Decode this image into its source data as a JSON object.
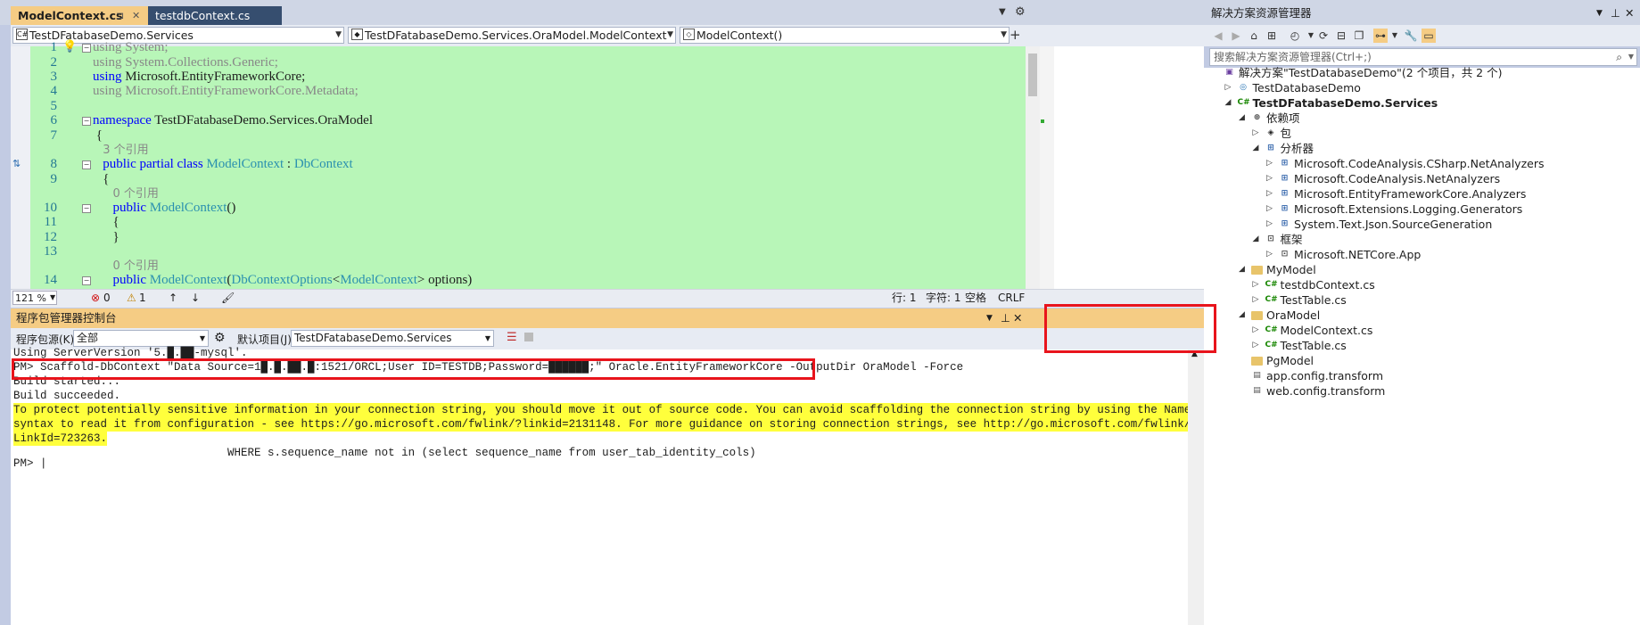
{
  "editor": {
    "tabs": [
      {
        "label": "ModelContext.cs",
        "active": true
      },
      {
        "label": "testdbContext.cs",
        "active": false
      }
    ],
    "tab_icons": {
      "pin": "⊐",
      "close": "✕"
    },
    "nav": {
      "project": "TestDFatabaseDemo.Services",
      "type": "TestDFatabaseDemo.Services.OraModel.ModelContext",
      "member": "ModelContext()"
    },
    "lines": [
      {
        "n": "1",
        "html": "<span class=\"gr\">using System;</span>"
      },
      {
        "n": "2",
        "html": "<span class=\"gr\">using System.Collections.Generic;</span>"
      },
      {
        "n": "3",
        "html": "<span class=\"kw\">using</span> Microsoft.EntityFrameworkCore;"
      },
      {
        "n": "4",
        "html": "<span class=\"gr\">using Microsoft.EntityFrameworkCore.Metadata;</span>"
      },
      {
        "n": "5",
        "html": ""
      },
      {
        "n": "6",
        "html": "<span class=\"kw\">namespace</span> TestDFatabaseDemo.Services.OraModel"
      },
      {
        "n": "7",
        "html": " {"
      },
      {
        "n": "",
        "html": "   <span class=\"ref\">3 个引用</span>"
      },
      {
        "n": "8",
        "html": "   <span class=\"kw\">public partial class</span> <span class=\"ty\">ModelContext</span> : <span class=\"ty\">DbContext</span>"
      },
      {
        "n": "9",
        "html": "   {"
      },
      {
        "n": "",
        "html": "      <span class=\"ref\">0 个引用</span>"
      },
      {
        "n": "10",
        "html": "      <span class=\"kw\">public</span> <span class=\"ty\">ModelContext</span>()"
      },
      {
        "n": "11",
        "html": "      {"
      },
      {
        "n": "12",
        "html": "      }"
      },
      {
        "n": "13",
        "html": ""
      },
      {
        "n": "",
        "html": "      <span class=\"ref\">0 个引用</span>"
      },
      {
        "n": "14",
        "html": "      <span class=\"kw\">public</span> <span class=\"ty\">ModelContext</span>(<span class=\"ty\">DbContextOptions</span>&lt;<span class=\"ty\">ModelContext</span>&gt; options)"
      }
    ],
    "status": {
      "zoom": "121 %",
      "errors": "0",
      "warnings": "1",
      "line": "行: 1",
      "col": "字符: 1",
      "spaces": "空格",
      "eol": "CRLF"
    }
  },
  "pmc": {
    "title": "程序包管理器控制台",
    "source_label": "程序包源(K):",
    "source_value": "全部",
    "project_label": "默认项目(J):",
    "project_value": "TestDFatabaseDemo.Services",
    "lines": [
      {
        "text": "Using ServerVersion '5.█.██-mysql'.",
        "hl": false
      },
      {
        "text": "PM> Scaffold-DbContext \"Data Source=1█.█.██.█:1521/ORCL;User ID=TESTDB;Password=██████;\" Oracle.EntityFrameworkCore -OutputDir OraModel -Force",
        "hl": false
      },
      {
        "text": "Build started...",
        "hl": false
      },
      {
        "text": "Build succeeded.",
        "hl": false
      },
      {
        "text": "To protect potentially sensitive information in your connection string, you should move it out of source code. You can avoid scaffolding the connection string by using the Name=",
        "hl": true
      },
      {
        "text": "syntax to read it from configuration - see https://go.microsoft.com/fwlink/?linkid=2131148. For more guidance on storing connection strings, see http://go.microsoft.com/fwlink/?",
        "hl": true
      },
      {
        "text": "LinkId=723263.",
        "hl": true
      },
      {
        "text": "                                WHERE s.sequence_name not in (select sequence_name from user_tab_identity_cols)",
        "hl": false
      },
      {
        "text": "",
        "hl": false
      },
      {
        "text": "PM> |",
        "hl": false
      }
    ]
  },
  "solution": {
    "title": "解决方案资源管理器",
    "search_placeholder": "搜索解决方案资源管理器(Ctrl+;)",
    "nodes": [
      {
        "label": "解决方案\"TestDatabaseDemo\"(2 个项目，共 2 个)",
        "depth": 0,
        "tri": "",
        "icon": "sln",
        "bold": false
      },
      {
        "label": "TestDatabaseDemo",
        "depth": 1,
        "tri": "▷",
        "icon": "web",
        "bold": false
      },
      {
        "label": "TestDFatabaseDemo.Services",
        "depth": 1,
        "tri": "◢",
        "icon": "csproj",
        "bold": true
      },
      {
        "label": "依赖项",
        "depth": 2,
        "tri": "◢",
        "icon": "deps",
        "bold": false
      },
      {
        "label": "包",
        "depth": 3,
        "tri": "▷",
        "icon": "pkg",
        "bold": false
      },
      {
        "label": "分析器",
        "depth": 3,
        "tri": "◢",
        "icon": "analyzer",
        "bold": false
      },
      {
        "label": "Microsoft.CodeAnalysis.CSharp.NetAnalyzers",
        "depth": 4,
        "tri": "▷",
        "icon": "analyzer",
        "bold": false
      },
      {
        "label": "Microsoft.CodeAnalysis.NetAnalyzers",
        "depth": 4,
        "tri": "▷",
        "icon": "analyzer",
        "bold": false
      },
      {
        "label": "Microsoft.EntityFrameworkCore.Analyzers",
        "depth": 4,
        "tri": "▷",
        "icon": "analyzer",
        "bold": false
      },
      {
        "label": "Microsoft.Extensions.Logging.Generators",
        "depth": 4,
        "tri": "▷",
        "icon": "analyzer",
        "bold": false
      },
      {
        "label": "System.Text.Json.SourceGeneration",
        "depth": 4,
        "tri": "▷",
        "icon": "analyzer",
        "bold": false
      },
      {
        "label": "框架",
        "depth": 3,
        "tri": "◢",
        "icon": "fw",
        "bold": false
      },
      {
        "label": "Microsoft.NETCore.App",
        "depth": 4,
        "tri": "▷",
        "icon": "fw",
        "bold": false
      },
      {
        "label": "MyModel",
        "depth": 2,
        "tri": "◢",
        "icon": "folder",
        "bold": false
      },
      {
        "label": "testdbContext.cs",
        "depth": 3,
        "tri": "▷",
        "icon": "cs",
        "bold": false
      },
      {
        "label": "TestTable.cs",
        "depth": 3,
        "tri": "▷",
        "icon": "cs",
        "bold": false
      },
      {
        "label": "OraModel",
        "depth": 2,
        "tri": "◢",
        "icon": "folder",
        "bold": false
      },
      {
        "label": "ModelContext.cs",
        "depth": 3,
        "tri": "▷",
        "icon": "cs",
        "bold": false
      },
      {
        "label": "TestTable.cs",
        "depth": 3,
        "tri": "▷",
        "icon": "cs",
        "bold": false
      },
      {
        "label": "PgModel",
        "depth": 2,
        "tri": "",
        "icon": "folder",
        "bold": false
      },
      {
        "label": "app.config.transform",
        "depth": 2,
        "tri": "",
        "icon": "file",
        "bold": false
      },
      {
        "label": "web.config.transform",
        "depth": 2,
        "tri": "",
        "icon": "file",
        "bold": false
      }
    ]
  }
}
